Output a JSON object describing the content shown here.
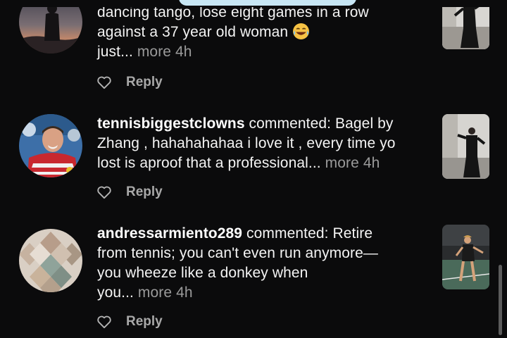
{
  "notifications": [
    {
      "username": "",
      "lines": [
        "dancing tango, lose eight games in a row",
        "against a 37 year old woman "
      ],
      "last_line_text": "just...",
      "more_label": "more",
      "time": "4h",
      "emoji": "laughing-tears-emoji",
      "reply_label": "Reply",
      "avatar_icon": "silhouette-sunset-avatar",
      "thumbnail_icon": "tango-video-thumbnail"
    },
    {
      "username": "tennisbiggestclowns",
      "action": " commented: Bagel by",
      "lines": [
        "Zhang , hahahahahaa i love it , every time yo"
      ],
      "last_line_text": "lost is  aproof that a professional...",
      "more_label": "more",
      "time": "4h",
      "reply_label": "Reply",
      "avatar_icon": "tennis-player-avatar",
      "thumbnail_icon": "tango-video-thumbnail"
    },
    {
      "username": "andressarmiento289",
      "action": " commented: Retire",
      "lines": [
        "from tennis; you can't even run anymore—",
        "you wheeze like a donkey when"
      ],
      "last_line_text": "you...",
      "more_label": "more",
      "time": "4h",
      "reply_label": "Reply",
      "avatar_icon": "mosaic-tile-avatar",
      "thumbnail_icon": "tennis-court-video-thumbnail"
    }
  ],
  "colors": {
    "background": "#0b0b0c",
    "text": "#f4f4f4",
    "muted": "#9a9a9a",
    "reply": "#a9a9a9"
  }
}
